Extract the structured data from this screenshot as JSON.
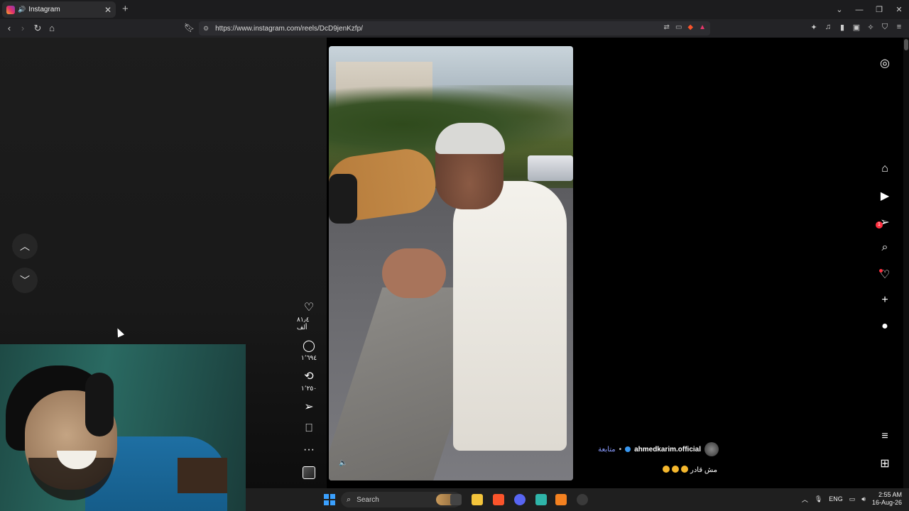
{
  "browser": {
    "tab_title": "Instagram",
    "url": "https://www.instagram.com/reels/DcD9jenKzfp/"
  },
  "reel": {
    "likes": "٨١٫٤ ألف",
    "comments": "١٬٦٩٤",
    "reposts": "١٬٢٥٠",
    "owner_username": "ahmedkarim.official",
    "follow_label": "متابعة",
    "dot": "•",
    "caption": "مش قادر"
  },
  "sidebar": {
    "messages_badge": "1"
  },
  "taskbar": {
    "search_placeholder": "Search",
    "language": "ENG",
    "time": "2:55 AM",
    "date": "16-Aug-26"
  },
  "colors": {
    "follow_link": "#8b9cff",
    "notification": "#ff3040",
    "brave": "#fb542b"
  }
}
